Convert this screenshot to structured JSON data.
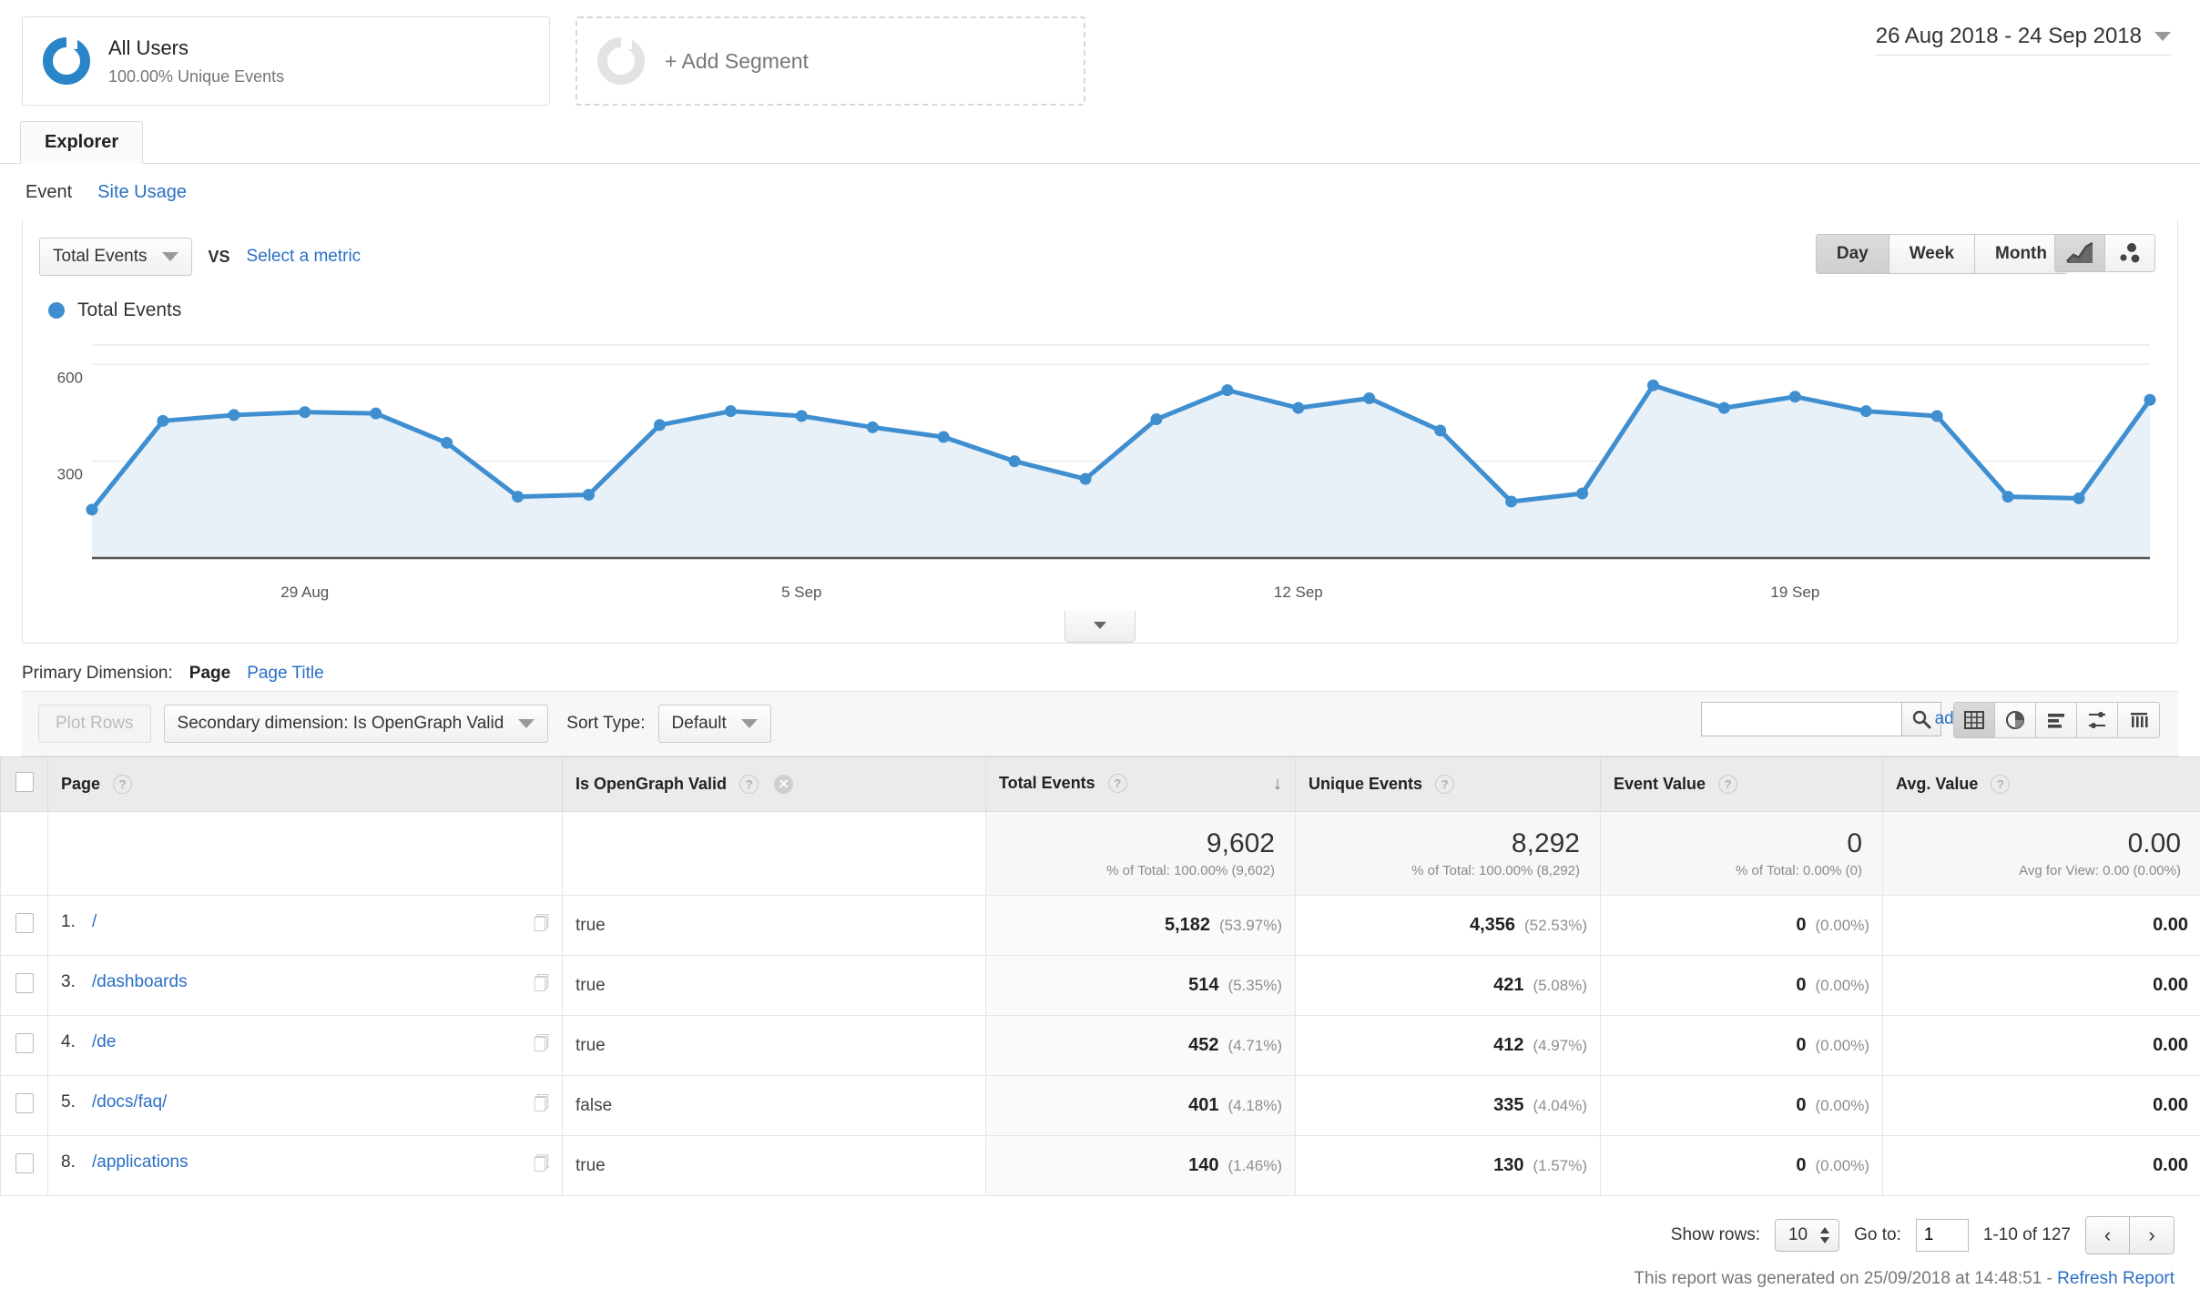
{
  "segments": {
    "all_users": {
      "title": "All Users",
      "subtitle": "100.00% Unique Events"
    },
    "add_segment_label": "+ Add Segment"
  },
  "date_range": {
    "value": "26 Aug 2018 - 24 Sep 2018"
  },
  "tabs": {
    "explorer": "Explorer"
  },
  "subtabs": {
    "event": "Event",
    "site_usage": "Site Usage"
  },
  "metric_row": {
    "primary_metric": "Total Events",
    "vs": "VS",
    "select_metric": "Select a metric",
    "granularity": {
      "day": "Day",
      "week": "Week",
      "month": "Month",
      "selected": "Day"
    }
  },
  "legend": {
    "label": "Total Events"
  },
  "chart_data": {
    "type": "area",
    "title": "Total Events",
    "xlabel": "",
    "ylabel": "",
    "ylim": [
      0,
      660
    ],
    "yticks": [
      300,
      600
    ],
    "grid": true,
    "legend": [
      "Total Events"
    ],
    "x": [
      "26 Aug",
      "27 Aug",
      "28 Aug",
      "29 Aug",
      "30 Aug",
      "31 Aug",
      "1 Sep",
      "2 Sep",
      "3 Sep",
      "4 Sep",
      "5 Sep",
      "6 Sep",
      "7 Sep",
      "8 Sep",
      "9 Sep",
      "10 Sep",
      "11 Sep",
      "12 Sep",
      "13 Sep",
      "14 Sep",
      "15 Sep",
      "16 Sep",
      "17 Sep",
      "18 Sep",
      "19 Sep",
      "20 Sep",
      "21 Sep",
      "22 Sep",
      "23 Sep",
      "24 Sep"
    ],
    "tick_labels": [
      "29 Aug",
      "5 Sep",
      "12 Sep",
      "19 Sep"
    ],
    "series": [
      {
        "name": "Total Events",
        "values": [
          150,
          425,
          443,
          452,
          448,
          357,
          190,
          196,
          412,
          455,
          440,
          405,
          375,
          300,
          245,
          430,
          520,
          465,
          495,
          395,
          175,
          200,
          535,
          465,
          500,
          455,
          440,
          190,
          185,
          490
        ]
      }
    ]
  },
  "primary_dimension": {
    "label": "Primary Dimension:",
    "selected": "Page",
    "alt": "Page Title"
  },
  "toolbar": {
    "plot_rows": "Plot Rows",
    "secondary_dimension": "Secondary dimension: Is OpenGraph Valid",
    "sort_type_label": "Sort Type:",
    "sort_type_value": "Default",
    "search_placeholder": "",
    "search_value": "",
    "advanced": "advanced"
  },
  "table": {
    "columns": [
      {
        "key": "page",
        "label": "Page"
      },
      {
        "key": "secondary",
        "label": "Is OpenGraph Valid"
      },
      {
        "key": "total_events",
        "label": "Total Events"
      },
      {
        "key": "unique_events",
        "label": "Unique Events"
      },
      {
        "key": "event_value",
        "label": "Event Value"
      },
      {
        "key": "avg_value",
        "label": "Avg. Value"
      }
    ],
    "sorted_column": "Total Events",
    "sort_direction": "desc",
    "totals": {
      "total_events": {
        "value": "9,602",
        "sub": "% of Total: 100.00% (9,602)"
      },
      "unique_events": {
        "value": "8,292",
        "sub": "% of Total: 100.00% (8,292)"
      },
      "event_value": {
        "value": "0",
        "sub": "% of Total: 0.00% (0)"
      },
      "avg_value": {
        "value": "0.00",
        "sub": "Avg for View: 0.00 (0.00%)"
      }
    },
    "rows": [
      {
        "index": "1.",
        "page": "/",
        "secondary": "true",
        "total_events": "5,182",
        "total_events_pct": "(53.97%)",
        "unique_events": "4,356",
        "unique_events_pct": "(52.53%)",
        "event_value": "0",
        "event_value_pct": "(0.00%)",
        "avg_value": "0.00"
      },
      {
        "index": "3.",
        "page": "/dashboards",
        "secondary": "true",
        "total_events": "514",
        "total_events_pct": "(5.35%)",
        "unique_events": "421",
        "unique_events_pct": "(5.08%)",
        "event_value": "0",
        "event_value_pct": "(0.00%)",
        "avg_value": "0.00"
      },
      {
        "index": "4.",
        "page": "/de",
        "secondary": "true",
        "total_events": "452",
        "total_events_pct": "(4.71%)",
        "unique_events": "412",
        "unique_events_pct": "(4.97%)",
        "event_value": "0",
        "event_value_pct": "(0.00%)",
        "avg_value": "0.00"
      },
      {
        "index": "5.",
        "page": "/docs/faq/",
        "secondary": "false",
        "total_events": "401",
        "total_events_pct": "(4.18%)",
        "unique_events": "335",
        "unique_events_pct": "(4.04%)",
        "event_value": "0",
        "event_value_pct": "(0.00%)",
        "avg_value": "0.00"
      },
      {
        "index": "8.",
        "page": "/applications",
        "secondary": "true",
        "total_events": "140",
        "total_events_pct": "(1.46%)",
        "unique_events": "130",
        "unique_events_pct": "(1.57%)",
        "event_value": "0",
        "event_value_pct": "(0.00%)",
        "avg_value": "0.00"
      }
    ]
  },
  "footer": {
    "show_rows_label": "Show rows:",
    "show_rows_value": "10",
    "go_to_label": "Go to:",
    "go_to_value": "1",
    "range_text": "1-10 of 127",
    "generated_text": "This report was generated on 25/09/2018 at 14:48:51 -",
    "refresh_label": "Refresh Report"
  },
  "colors": {
    "accent": "#3f8fd0",
    "link": "#2a6fc4",
    "area_fill": "#e8f0f8"
  }
}
